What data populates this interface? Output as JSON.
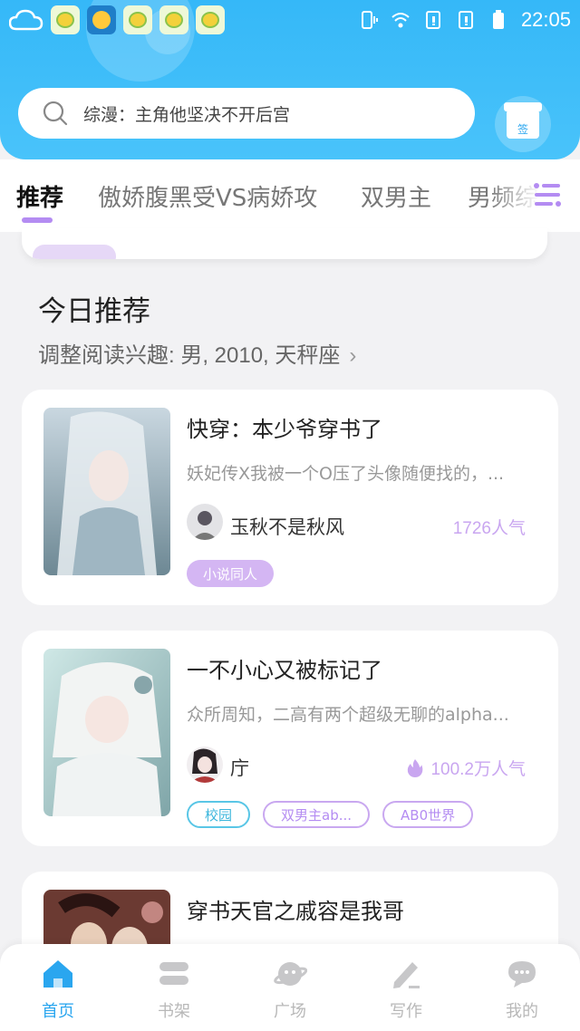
{
  "status_bar": {
    "time": "22:05"
  },
  "search": {
    "text": "综漫：主角他坚决不开后宫"
  },
  "gift": {
    "label": "签"
  },
  "tabs": [
    {
      "label": "推荐"
    },
    {
      "label": "傲娇腹黑受VS病娇攻"
    },
    {
      "label": "双男主"
    },
    {
      "label": "男频综"
    }
  ],
  "section": {
    "title": "今日推荐",
    "subtitle": "调整阅读兴趣: 男, 2010, 天秤座"
  },
  "books": [
    {
      "title": "快穿：本少爷穿书了",
      "desc": "妖妃传X我被一个O压了头像随便找的，...",
      "author": "玉秋不是秋风",
      "popularity": "1726人气",
      "tags": [
        "小说同人"
      ]
    },
    {
      "title": "一不小心又被标记了",
      "desc": "众所周知，二高有两个超级无聊的alpha...",
      "author": "庁",
      "popularity": "100.2万人气",
      "tags": [
        "校园",
        "双男主ab...",
        "AB0世界"
      ]
    },
    {
      "title": "穿书天官之戚容是我哥"
    }
  ],
  "bottom_nav": [
    {
      "label": "首页"
    },
    {
      "label": "书架"
    },
    {
      "label": "广场"
    },
    {
      "label": "写作"
    },
    {
      "label": "我的"
    }
  ],
  "colors": {
    "header": "#3cbcf9",
    "accent_blue": "#2aa6ef",
    "accent_purple": "#b48cf2",
    "tag_teal": "#59c6e6"
  }
}
